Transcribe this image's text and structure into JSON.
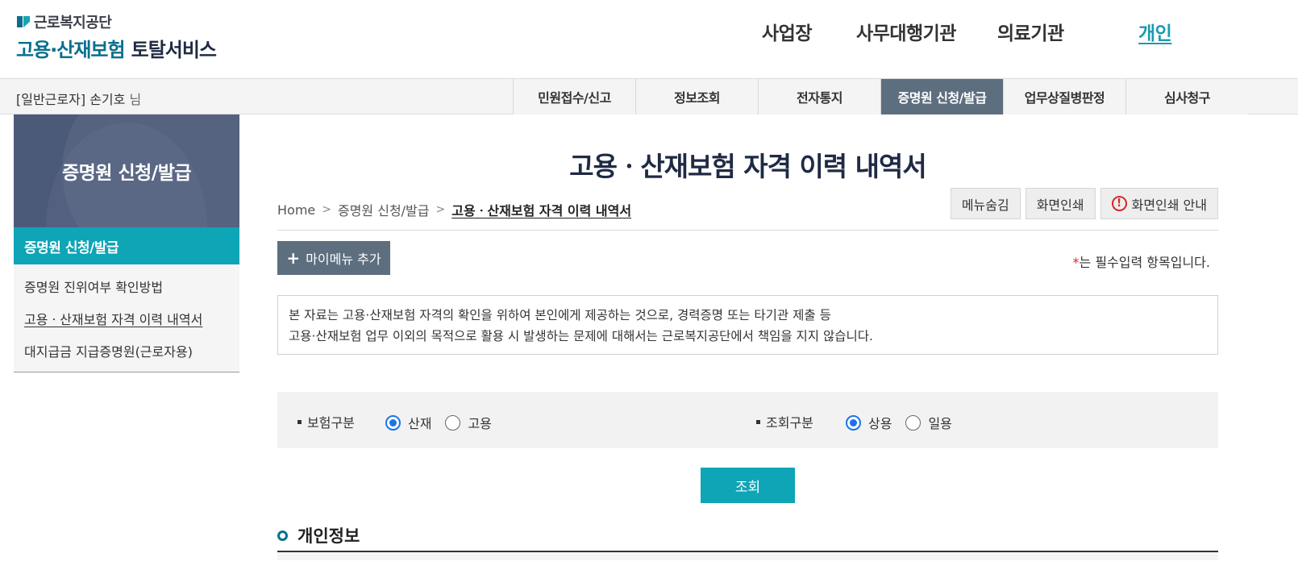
{
  "logo": {
    "org_name": "근로복지공단",
    "service_highlight": "고용·산재보험",
    "service_rest": "토탈서비스"
  },
  "gnb": [
    {
      "label": "사업장"
    },
    {
      "label": "사무대행기관"
    },
    {
      "label": "의료기관"
    },
    {
      "label": "개인",
      "active": true
    }
  ],
  "user": {
    "role": "[일반근로자]",
    "name": "손기호",
    "honorific": "님"
  },
  "tabs": [
    {
      "label": "민원접수/신고"
    },
    {
      "label": "정보조회"
    },
    {
      "label": "전자통지"
    },
    {
      "label": "증명원 신청/발급",
      "active": true
    },
    {
      "label": "업무상질병판정"
    },
    {
      "label": "심사청구"
    }
  ],
  "lnb": {
    "title": "증명원 신청/발급",
    "section": "증명원 신청/발급",
    "items": [
      {
        "label": "증명원 진위여부 확인방법"
      },
      {
        "label": "고용ㆍ산재보험 자격 이력 내역서",
        "current": true
      },
      {
        "label": "대지급금 지급증명원(근로자용)"
      }
    ]
  },
  "page": {
    "title": "고용ㆍ산재보험 자격 이력 내역서",
    "breadcrumb": [
      "Home",
      "증명원 신청/발급",
      "고용ㆍ산재보험 자격 이력 내역서"
    ],
    "util_buttons": {
      "hide_menu": "메뉴숨김",
      "print": "화면인쇄",
      "print_guide": "화면인쇄 안내",
      "warn_glyph": "!"
    },
    "mymenu_plus": "+",
    "mymenu_label": "마이메뉴 추가",
    "required_star": "*",
    "required_note": "는 필수입력 항목입니다.",
    "notice_lines": [
      "본 자료는 고용·산재보험 자격의 확인을 위하여 본인에게 제공하는 것으로, 경력증명 또는 타기관 제출 등",
      "고용·산재보험 업무 이외의 목적으로 활용 시 발생하는 문제에 대해서는 근로복지공단에서 책임을 지지 않습니다."
    ]
  },
  "search": {
    "insurance_type": {
      "label": "보험구분",
      "options": [
        "산재",
        "고용"
      ],
      "selected": "산재"
    },
    "inquiry_type": {
      "label": "조회구분",
      "options": [
        "상용",
        "일용"
      ],
      "selected": "상용"
    },
    "submit_label": "조회"
  },
  "section": {
    "personal_info_title": "개인정보"
  },
  "colors": {
    "accent_teal": "#0ea5b6",
    "nav_slate": "#5d6e7f",
    "sidebar_navy": "#4c5a7a",
    "radio_blue": "#1a73e8",
    "required_red": "#d9262a"
  }
}
